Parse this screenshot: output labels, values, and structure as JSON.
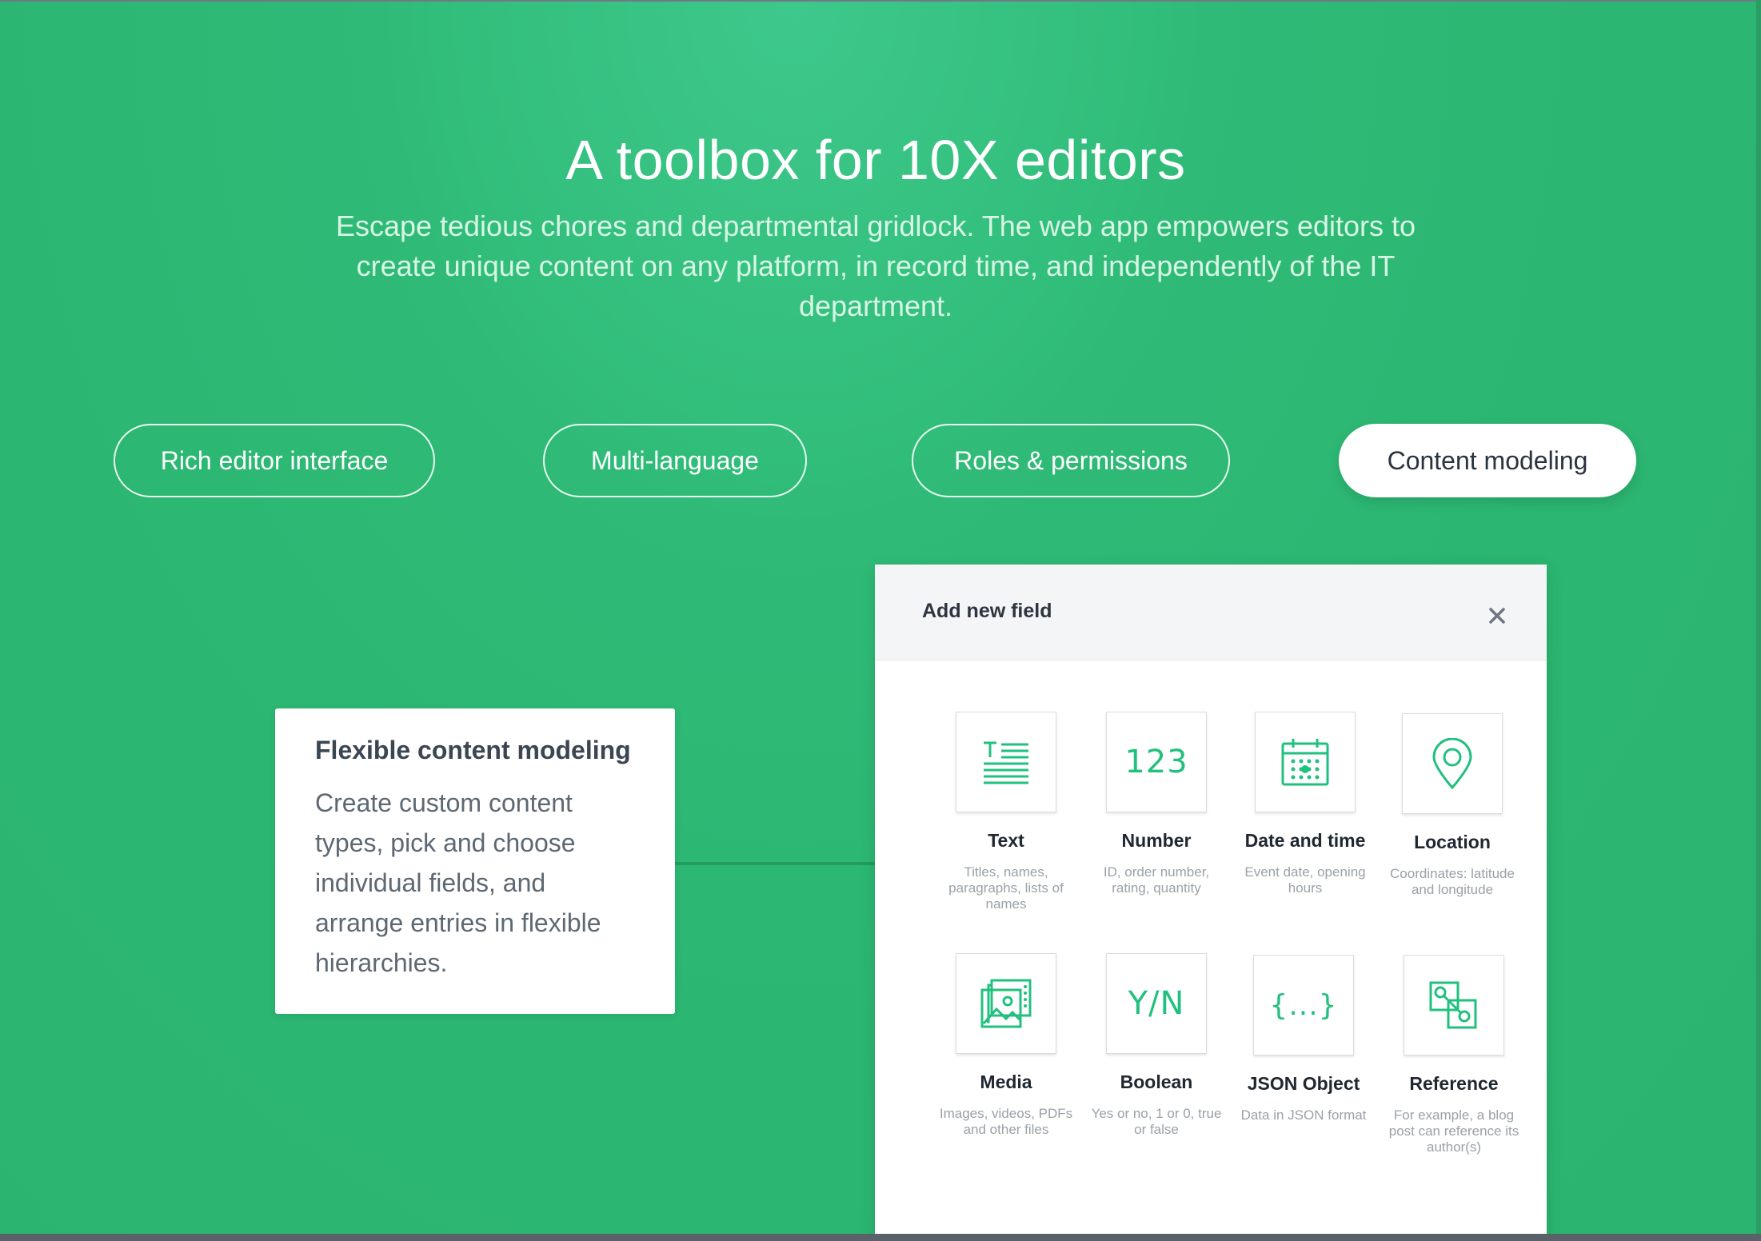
{
  "hero": {
    "title": "A toolbox for 10X editors",
    "subtitle": "Escape tedious chores and departmental gridlock. The web app empowers editors to create unique content on any platform, in record time, and independently of the IT department."
  },
  "tabs": [
    {
      "label": "Rich editor interface",
      "active": false
    },
    {
      "label": "Multi-language",
      "active": false
    },
    {
      "label": "Roles & permissions",
      "active": false
    },
    {
      "label": "Content modeling",
      "active": true
    }
  ],
  "info_card": {
    "title": "Flexible content modeling",
    "body": "Create custom content types, pick and choose individual fields, and arrange entries in flexible hierarchies."
  },
  "panel": {
    "title": "Add new field",
    "close_icon": "close-icon"
  },
  "fields": [
    {
      "icon": "text-icon",
      "glyph": "",
      "label": "Text",
      "desc": "Titles, names, paragraphs, lists of names"
    },
    {
      "icon": "number-icon",
      "glyph": "123",
      "label": "Number",
      "desc": "ID, order number, rating, quantity"
    },
    {
      "icon": "calendar-icon",
      "glyph": "",
      "label": "Date and time",
      "desc": "Event date, opening hours"
    },
    {
      "icon": "location-pin-icon",
      "glyph": "",
      "label": "Location",
      "desc": "Coordinates: latitude and longitude"
    },
    {
      "icon": "media-icon",
      "glyph": "",
      "label": "Media",
      "desc": "Images, videos, PDFs and other files"
    },
    {
      "icon": "boolean-icon",
      "glyph": "Y/N",
      "label": "Boolean",
      "desc": "Yes or no, 1 or 0, true or false"
    },
    {
      "icon": "json-icon",
      "glyph": "{...}",
      "label": "JSON Object",
      "desc": "Data in JSON format"
    },
    {
      "icon": "reference-icon",
      "glyph": "",
      "label": "Reference",
      "desc": "For example, a blog post can reference its author(s)"
    }
  ],
  "colors": {
    "background": "#2bb671",
    "accent": "#22c07f",
    "text_dark": "#2a3440"
  }
}
